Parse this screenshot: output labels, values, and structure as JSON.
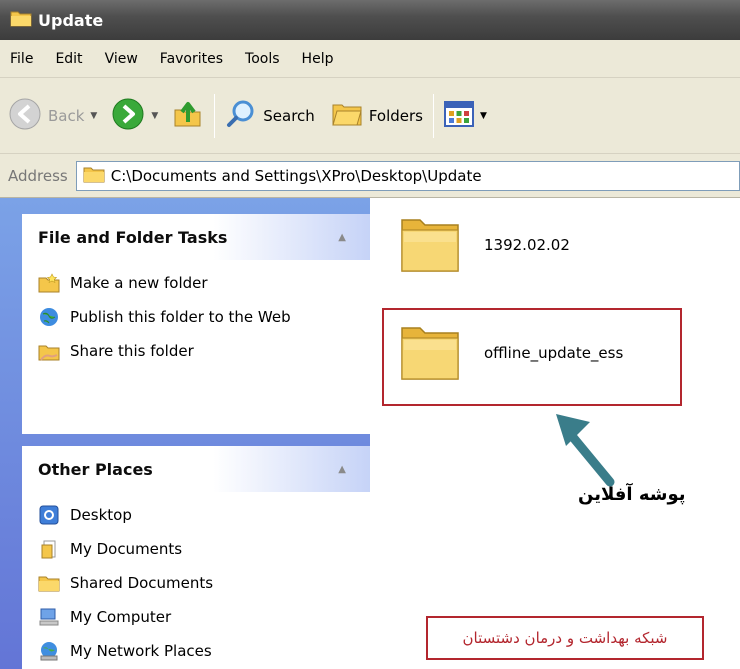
{
  "window": {
    "title": "Update"
  },
  "menu": [
    "File",
    "Edit",
    "View",
    "Favorites",
    "Tools",
    "Help"
  ],
  "toolbar": {
    "back_label": "Back",
    "search_label": "Search",
    "folders_label": "Folders"
  },
  "address": {
    "label": "Address",
    "value": "C:\\Documents and Settings\\XPro\\Desktop\\Update"
  },
  "tasks_panel": {
    "title": "File and Folder Tasks",
    "items": [
      {
        "label": "Make a new folder",
        "icon": "new-folder-icon"
      },
      {
        "label": "Publish this folder to the Web",
        "icon": "publish-web-icon"
      },
      {
        "label": "Share this folder",
        "icon": "share-folder-icon"
      }
    ]
  },
  "places_panel": {
    "title": "Other Places",
    "items": [
      {
        "label": "Desktop",
        "icon": "desktop-icon"
      },
      {
        "label": "My Documents",
        "icon": "my-documents-icon"
      },
      {
        "label": "Shared Documents",
        "icon": "shared-documents-icon"
      },
      {
        "label": "My Computer",
        "icon": "my-computer-icon"
      },
      {
        "label": "My Network Places",
        "icon": "network-places-icon"
      }
    ]
  },
  "files": [
    {
      "name": "1392.02.02",
      "icon": "folder-icon"
    },
    {
      "name": "offline_update_ess",
      "icon": "folder-icon"
    }
  ],
  "annotations": {
    "arrow_label": "پوشه آفلاین",
    "credit": "شبکه بهداشت و درمان دشتستان"
  },
  "colors": {
    "titlebar": "#4f4f4f",
    "chrome": "#ece9d8",
    "taskpane": "#6375d6",
    "annotation": "#b3262e"
  }
}
